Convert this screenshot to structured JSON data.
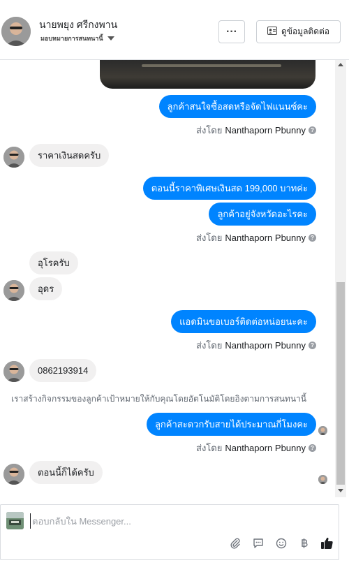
{
  "header": {
    "name": "นายพยุง ศรีกงพาน",
    "subtitle": "มอบหมายการสนทนานี้",
    "more_label": "···",
    "contact_label": "ดูข้อมูลติดต่อ"
  },
  "messages": {
    "m1": "ลูกค้าสนใจซื้อสดหรือจัดไฟแนนซ์คะ",
    "sent1_prefix": "ส่งโดย",
    "sent1_who": "Nanthaporn Pbunny",
    "m2": "ราคาเงินสดครับ",
    "m3": "ตอนนี้ราคาพิเศษเงินสด 199,000 บาทค่ะ",
    "m4": "ลูกค้าอยู่จังหวัดอะไรคะ",
    "sent2_prefix": "ส่งโดย",
    "sent2_who": "Nanthaporn Pbunny",
    "m5": "อุโรครับ",
    "m6": "อุดร",
    "m7": "แอดมินขอเบอร์ติดต่อหน่อยนะคะ",
    "sent3_prefix": "ส่งโดย",
    "sent3_who": "Nanthaporn Pbunny",
    "m8": "0862193914",
    "system_note": "เราสร้างกิจกรรมของลูกค้าเป้าหมายให้กับคุณโดยอัตโนมัติโดยอิงตามการสนทนานี้",
    "m9": "ลูกค้าสะดวกรับสายได้ประมาณกี่โมงคะ",
    "sent4_prefix": "ส่งโดย",
    "sent4_who": "Nanthaporn Pbunny",
    "m10": "ตอนนี้ก็ได้ครับ"
  },
  "composer": {
    "placeholder": "ตอบกลับใน Messenger..."
  },
  "icons": {
    "attach": "paperclip-icon",
    "quick_reply": "chat-bubble-icon",
    "emoji": "smiley-icon",
    "currency": "baht-icon",
    "like": "thumbs-up-icon"
  },
  "colors": {
    "outgoing_bubble": "#0084ff",
    "incoming_bubble": "#f1f0f0",
    "like_icon": "#1c1e21"
  }
}
